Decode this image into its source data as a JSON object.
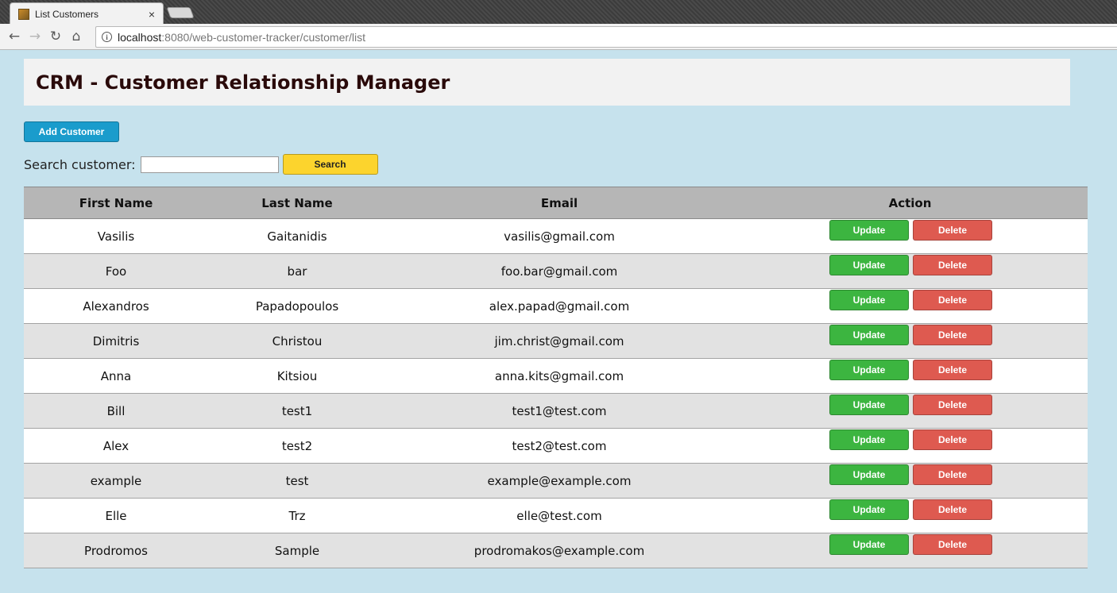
{
  "browser": {
    "tab_title": "List Customers",
    "tab_close": "×",
    "nav_back": "←",
    "nav_forward": "→",
    "nav_reload": "↻",
    "nav_home": "⌂",
    "info_glyph": "i",
    "url_host": "localhost",
    "url_rest": ":8080/web-customer-tracker/customer/list"
  },
  "page": {
    "title": "CRM - Customer Relationship Manager",
    "add_button": "Add Customer",
    "search_label": "Search customer:",
    "search_value": "",
    "search_button": "Search"
  },
  "table": {
    "headers": [
      "First Name",
      "Last Name",
      "Email",
      "Action"
    ],
    "update_label": "Update",
    "delete_label": "Delete",
    "rows": [
      {
        "first": "Vasilis",
        "last": "Gaitanidis",
        "email": "vasilis@gmail.com"
      },
      {
        "first": "Foo",
        "last": "bar",
        "email": "foo.bar@gmail.com"
      },
      {
        "first": "Alexandros",
        "last": "Papadopoulos",
        "email": "alex.papad@gmail.com"
      },
      {
        "first": "Dimitris",
        "last": "Christou",
        "email": "jim.christ@gmail.com"
      },
      {
        "first": "Anna",
        "last": "Kitsiou",
        "email": "anna.kits@gmail.com"
      },
      {
        "first": "Bill",
        "last": "test1",
        "email": "test1@test.com"
      },
      {
        "first": "Alex",
        "last": "test2",
        "email": "test2@test.com"
      },
      {
        "first": "example",
        "last": "test",
        "email": "example@example.com"
      },
      {
        "first": "Elle",
        "last": "Trz",
        "email": "elle@test.com"
      },
      {
        "first": "Prodromos",
        "last": "Sample",
        "email": "prodromakos@example.com"
      }
    ]
  },
  "colors": {
    "background": "#c6e2ed",
    "add_button": "#1a9ccc",
    "search_button": "#fcd42d",
    "update_button": "#3cb540",
    "delete_button": "#de5a50"
  }
}
